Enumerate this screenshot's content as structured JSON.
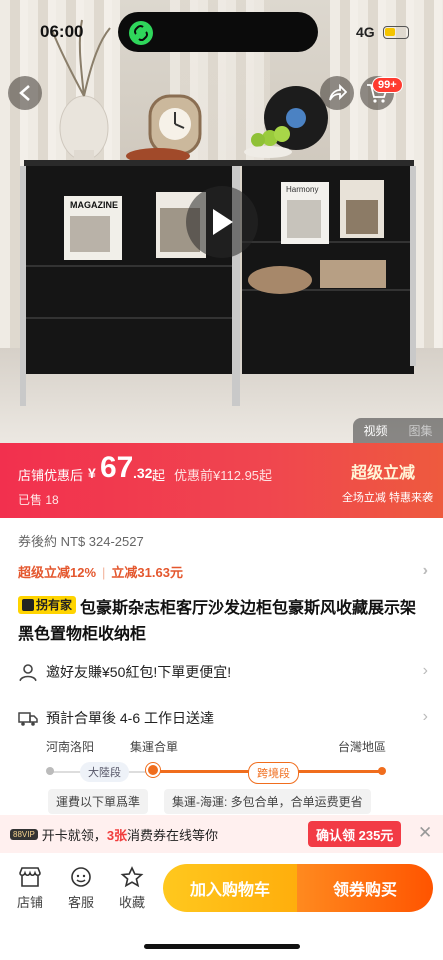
{
  "status_bar": {
    "time": "06:00",
    "network": "4G"
  },
  "hero": {
    "cart_badge": "99+",
    "media_tabs": [
      {
        "label": "视频",
        "active": true
      },
      {
        "label": "图集",
        "active": false
      }
    ],
    "cover_texts": [
      "MAGAZINE",
      "Harmony"
    ]
  },
  "price": {
    "label": "店铺优惠后",
    "currency": "¥",
    "integer": "67",
    "decimal": ".32",
    "suffix": "起",
    "before": "优惠前¥112.95起",
    "sold": "已售 18",
    "super_title": "超级立减",
    "super_sub": "全场立减 特惠来袭"
  },
  "coupon_range": "券後約 NT$ 324-2527",
  "discount": {
    "a": "超级立减12%",
    "b": "立减31.63元"
  },
  "product": {
    "brand_badge": "拐有家",
    "title": "包豪斯杂志柜客厅沙发边柜包豪斯风收藏展示架黑色置物柜收纳柜"
  },
  "invite": "邀好友賺¥50紅包!下單更便宜!",
  "shipping": {
    "estimate": "預計合單後 4-6 工作日送達",
    "origin": "河南洛阳",
    "hub": "集運合單",
    "destination": "台灣地區",
    "segment1": "大陸段",
    "segment2": "跨境段",
    "note1": "運費以下單爲準",
    "note2": "集運-海運: 多包合单，合单运费更省"
  },
  "promo": {
    "vip_tag": "88VIP",
    "text_pre": "开卡就领，",
    "count": "3张",
    "text_post": "消费券在线等你",
    "claim_label": "确认领 235元"
  },
  "bottom_nav": {
    "store": "店铺",
    "service": "客服",
    "favorite": "收藏",
    "add_cart": "加入购物车",
    "buy": "领券购买"
  },
  "colors": {
    "price_bar": "#f2304e",
    "accent_orange": "#f06d1d",
    "cart_yellow": "#ffb915",
    "buy_orange": "#ff5a00"
  }
}
